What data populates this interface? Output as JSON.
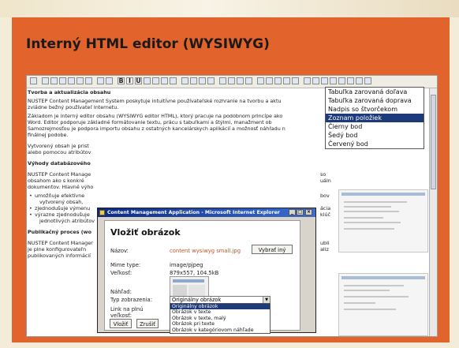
{
  "page": {
    "title": "Interný HTML editor (WYSIWYG)"
  },
  "colors": {
    "accent": "#e2632b",
    "background": "#f3ecd8",
    "selection": "#1d3a7a",
    "link_orange": "#c2562a"
  },
  "toolbar": {
    "icons": [
      "source-icon",
      "cut-icon",
      "copy-icon",
      "paste-icon",
      "paste-text-icon",
      "paste-word-icon",
      "format-clear-icon",
      "undo-icon",
      "redo-icon",
      "bold-icon",
      "italic-icon",
      "underline-icon",
      "strikethrough-icon",
      "subscript-icon",
      "superscript-icon",
      "remove-format-icon",
      "align-left-icon",
      "align-center-icon",
      "align-right-icon",
      "justify-icon",
      "numbered-list-icon",
      "bulleted-list-icon",
      "outdent-icon",
      "indent-icon",
      "image-icon",
      "table-icon",
      "link-icon",
      "anchor-icon",
      "special-char-icon",
      "table-insert-icon",
      "table-props-icon",
      "row-insert-icon",
      "col-insert-icon",
      "merge-cells-icon",
      "split-cells-icon",
      "delete-icon",
      "help-icon"
    ],
    "bold_label": "B",
    "italic_label": "I",
    "underline_label": "U"
  },
  "document": {
    "lines": [
      {
        "text": "Tvorba a aktualizácia obsahu",
        "bold": true
      },
      {
        "text": "NUSTEP Content Management System poskytuje intuitívne používateľské rozhranie na tvorbu a aktu"
      },
      {
        "text": "zvládne bežný používateľ Internetu."
      },
      {
        "text": "Základom je interný editor obsahu (WYSIWYG editor HTML), ktorý pracuje na podobnom princípe ako"
      },
      {
        "text": "Word. Editor podporuje základné formátovanie textu, prácu s tabuľkami a štýlmi, manažment ob"
      },
      {
        "text": "Samozrejmosťou je podpora importu obsahu z ostatných kancelárskych aplikácií a možnosť náhľadu n"
      },
      {
        "text": "finálnej podobe."
      },
      {
        "text": "Vytvorený obsah je prist"
      },
      {
        "text": "alebo pomocou atribútov"
      },
      {
        "text": "Výhody databázového",
        "bold": true
      },
      {
        "text": "NUSTEP Content Manage"
      },
      {
        "text": "obsahom ako s konkré"
      },
      {
        "text": "dokumentov. Hlavné výho"
      },
      {
        "text": "umožňuje efektívne",
        "bullet": true
      },
      {
        "text": "vytvorený obsah,"
      },
      {
        "text": "zjednodušuje výmenu",
        "bullet": true
      },
      {
        "text": "výrazne zjednodušuje",
        "bullet": true
      },
      {
        "text": "jednotlivých atribútov"
      },
      {
        "text": "Publikačný proces (wo",
        "bold": true
      },
      {
        "text": "NUSTEP Content Manager"
      },
      {
        "text": "je plne konfigurovateľn"
      },
      {
        "text": "publikovaných informácií"
      }
    ],
    "right_fragments": [
      "so",
      "uáln",
      "bov",
      "ácia",
      "klúč",
      "ubli",
      "aliz"
    ]
  },
  "context_menu": {
    "items": [
      {
        "label": "Tabuľka zarovaná doľava",
        "selected": false
      },
      {
        "label": "Tabuľka zarovaná doprava",
        "selected": false
      },
      {
        "label": "Nadpis so štvorčekom",
        "selected": false
      },
      {
        "label": "Zoznam položiek",
        "selected": true
      },
      {
        "label": "Čierny bod",
        "selected": false
      },
      {
        "label": "Šedý bod",
        "selected": false
      },
      {
        "label": "Červený bod",
        "selected": false
      }
    ]
  },
  "dialog": {
    "window_title": "Content Management Application - Microsoft Internet Explorer",
    "heading": "Vložiť obrázok",
    "fields": {
      "name_label": "Názov:",
      "name_value": "content wysiwyg small.jpg",
      "browse_button": "Vybrať iný",
      "mime_label": "Mime type:",
      "mime_value": "image/pjpeg",
      "size_label": "Veľkosť:",
      "size_value": "879x557, 104.5kB",
      "preview_label": "Náhľad:",
      "display_label": "Typ zobrazenia:",
      "display_value": "Originálny obrázok",
      "link_label_1": "Link na plnú",
      "link_label_2": "veľkosť:"
    },
    "display_options": [
      {
        "label": "Originálny obrázok",
        "selected": true
      },
      {
        "label": "Obrázok v texte",
        "selected": false
      },
      {
        "label": "Obrázok v texte, malý",
        "selected": false
      },
      {
        "label": "Obrázok pri texte",
        "selected": false
      },
      {
        "label": "Obrázok v kategóriovom náhľade",
        "selected": false
      }
    ],
    "insert_button": "Vložiť",
    "cancel_button": "Zrušiť"
  }
}
